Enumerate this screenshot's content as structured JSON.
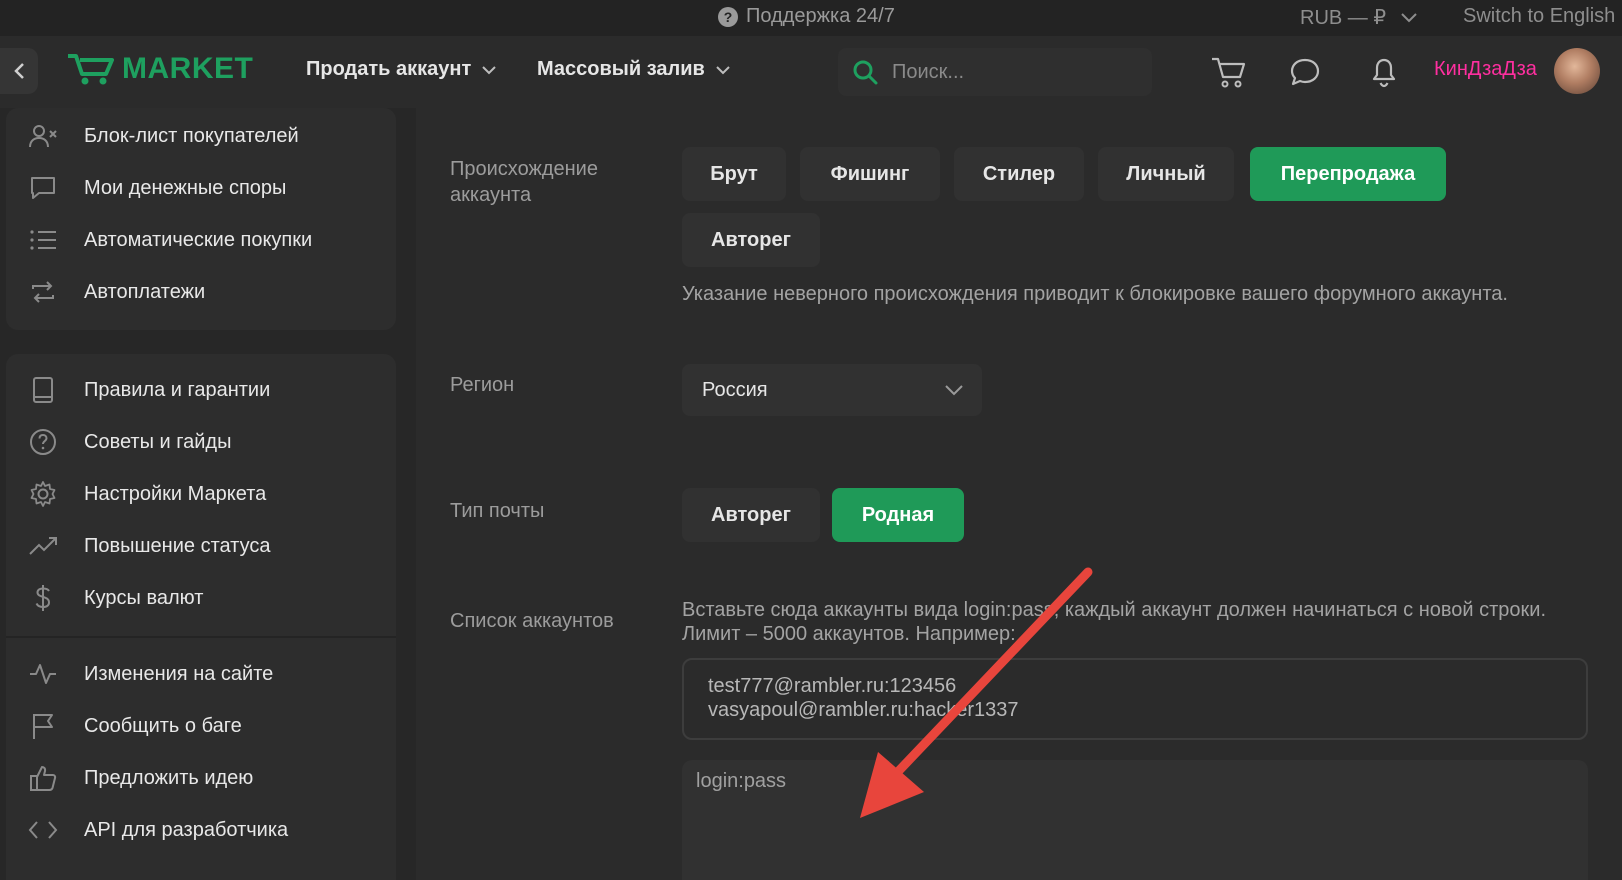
{
  "topbar": {
    "support_label": "Поддержка 24/7",
    "currency_label": "RUB — ₽",
    "language_switch": "Switch to English"
  },
  "header": {
    "logo_text": "MARKET",
    "nav": [
      {
        "label": "Продать аккаунт"
      },
      {
        "label": "Массовый залив"
      }
    ],
    "search_placeholder": "Поиск...",
    "username": "КинДзаДза",
    "username_color": "#ff2fa0",
    "icons": [
      "cart-icon",
      "chat-icon",
      "bell-icon"
    ]
  },
  "sidebar": {
    "group1": [
      {
        "label": "Блок-лист покупателей",
        "icon": "user-block-icon"
      },
      {
        "label": "Мои денежные споры",
        "icon": "chat-bubble-icon"
      },
      {
        "label": "Автоматические покупки",
        "icon": "list-icon"
      },
      {
        "label": "Автоплатежи",
        "icon": "repeat-icon"
      }
    ],
    "group2": [
      {
        "label": "Правила и гарантии",
        "icon": "book-icon"
      },
      {
        "label": "Советы и гайды",
        "icon": "help-circle-icon"
      },
      {
        "label": "Настройки Маркета",
        "icon": "gear-icon"
      },
      {
        "label": "Повышение статуса",
        "icon": "trending-up-icon"
      },
      {
        "label": "Курсы валют",
        "icon": "dollar-icon"
      }
    ],
    "group3": [
      {
        "label": "Изменения на сайте",
        "icon": "activity-icon"
      },
      {
        "label": "Сообщить о баге",
        "icon": "flag-icon"
      },
      {
        "label": "Предложить идею",
        "icon": "thumbs-up-icon"
      },
      {
        "label": "API для разработчика",
        "icon": "code-icon"
      }
    ]
  },
  "form": {
    "origin": {
      "label_line1": "Происхождение",
      "label_line2": "аккаунта",
      "options": [
        "Брут",
        "Фишинг",
        "Стилер",
        "Личный",
        "Перепродажа",
        "Авторег"
      ],
      "selected": "Перепродажа",
      "hint": "Указание неверного происхождения приводит к блокировке вашего форумного аккаунта."
    },
    "region": {
      "label": "Регион",
      "value": "Россия"
    },
    "mail_type": {
      "label": "Тип почты",
      "options": [
        "Авторег",
        "Родная"
      ],
      "selected": "Родная"
    },
    "accounts": {
      "label": "Список аккаунтов",
      "hint_line1": "Вставьте сюда аккаунты вида login:pass, каждый аккаунт должен начинаться с новой строки.",
      "hint_line2": "Лимит – 5000 аккаунтов. Например:",
      "example_line1": "test777@rambler.ru:123456",
      "example_line2": "vasyapoul@rambler.ru:hacker1337",
      "placeholder": "login:pass"
    }
  },
  "colors": {
    "accent_green": "#1f9a58",
    "annotation_arrow": "#e8453c"
  }
}
